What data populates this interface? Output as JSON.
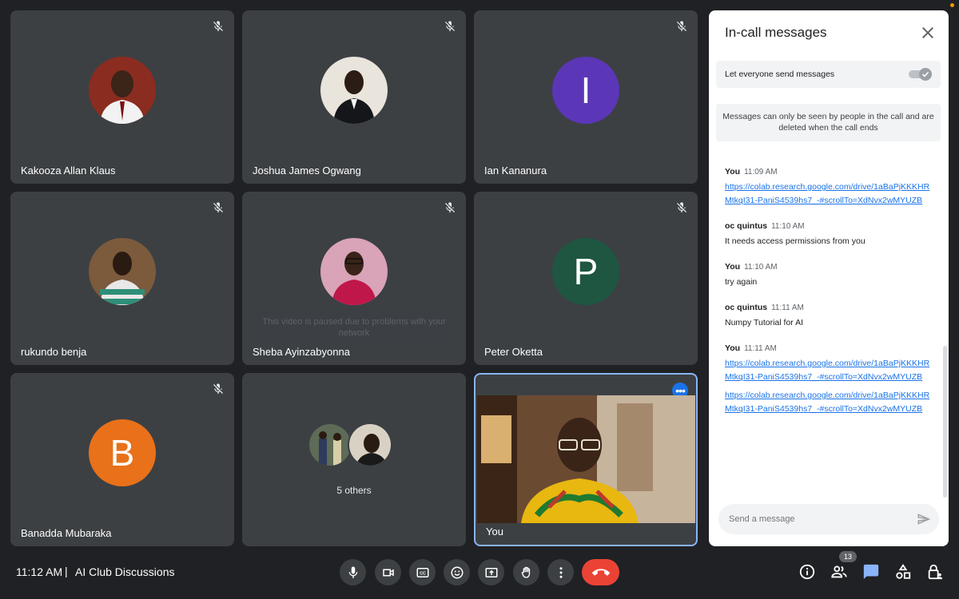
{
  "participants": [
    {
      "name": "Kakooza Allan Klaus"
    },
    {
      "name": "Joshua James Ogwang"
    },
    {
      "name": "Ian Kananura",
      "initial": "I",
      "color": "#5b36b7"
    },
    {
      "name": "rukundo benja"
    },
    {
      "name": "Sheba Ayinzabyonna",
      "paused_message": "This video is paused due to problems with your network"
    },
    {
      "name": "Peter Oketta",
      "initial": "P",
      "color": "#1e5641"
    },
    {
      "name": "Banadda Mubaraka",
      "initial": "B",
      "color": "#e8711a"
    },
    {
      "others_label": "5 others"
    },
    {
      "name": "You"
    }
  ],
  "chat": {
    "title": "In-call messages",
    "toggle_label": "Let everyone send messages",
    "toggle_on": true,
    "info": "Messages can only be seen by people in the call and are deleted when the call ends",
    "messages": [
      {
        "sender": "You",
        "time": "11:09 AM",
        "link": "https://colab.research.google.com/drive/1aBaPjKKKHRMtkqI31-PaniS4539hs7_-#scrollTo=XdNvx2wMYUZB"
      },
      {
        "sender": "oc quintus",
        "time": "11:10 AM",
        "text": "It needs access permissions from you"
      },
      {
        "sender": "You",
        "time": "11:10 AM",
        "text": "try again"
      },
      {
        "sender": "oc quintus",
        "time": "11:11 AM",
        "text": "Numpy Tutorial for AI"
      },
      {
        "sender": "You",
        "time": "11:11 AM",
        "link": "https://colab.research.google.com/drive/1aBaPjKKKHRMtkqI31-PaniS4539hs7_-#scrollTo=XdNvx2wMYUZB",
        "link2": "https://colab.research.google.com/drive/1aBaPjKKKHRMtkqI31-PaniS4539hs7_-#scrollTo=XdNvx2wMYUZB"
      }
    ],
    "input_placeholder": "Send a message"
  },
  "bottom": {
    "time": "11:12 AM",
    "separator": "|",
    "meeting_name": "AI Club Discussions",
    "people_count": "13"
  },
  "colors": {
    "accent": "#1a73e8",
    "hangup": "#ea4335",
    "tile": "#3c4043",
    "bg": "#202124"
  }
}
